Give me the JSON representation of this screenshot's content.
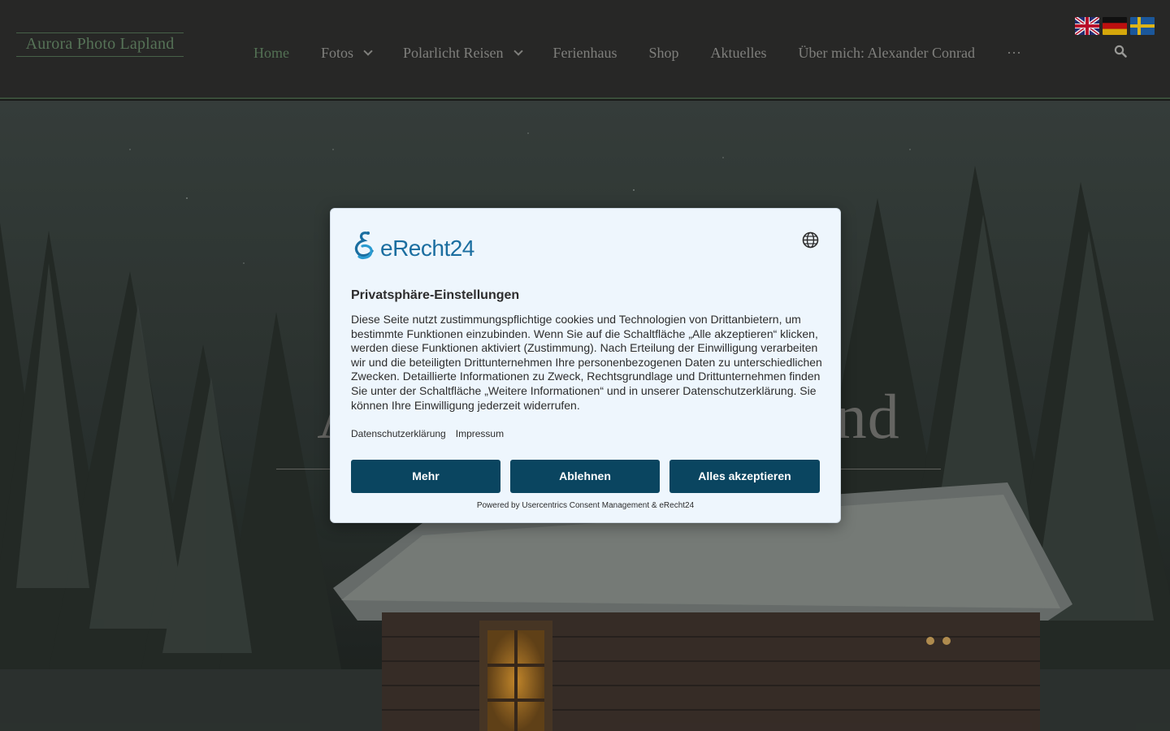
{
  "header": {
    "logo": "Aurora Photo Lapland",
    "nav": [
      {
        "label": "Home",
        "active": true,
        "dropdown": false
      },
      {
        "label": "Fotos",
        "active": false,
        "dropdown": true
      },
      {
        "label": "Polarlicht Reisen",
        "active": false,
        "dropdown": true
      },
      {
        "label": "Ferienhaus",
        "active": false,
        "dropdown": false
      },
      {
        "label": "Shop",
        "active": false,
        "dropdown": false
      },
      {
        "label": "Aktuelles",
        "active": false,
        "dropdown": false
      },
      {
        "label": "Über mich: Alexander Conrad",
        "active": false,
        "dropdown": false
      }
    ],
    "more": "···",
    "icons": {
      "search": "search-icon"
    },
    "languages": [
      "english-flag",
      "german-flag",
      "swedish-flag"
    ]
  },
  "hero": {
    "title": "Aurora Photo Lapland"
  },
  "consent": {
    "brand": "eRecht24",
    "title": "Privatsphäre-Einstellungen",
    "body": "Diese Seite nutzt zustimmungspflichtige cookies und Technologien von Drittanbietern, um bestimmte Funktionen einzubinden. Wenn Sie auf die Schaltfläche „Alle akzeptieren“ klicken, werden diese Funktionen aktiviert (Zustimmung). Nach Erteilung der Einwilligung verarbeiten wir und die beteiligten Drittunternehmen Ihre personenbezogenen Daten zu unterschiedlichen Zwecken. Detaillierte Informationen zu Zweck, Rechtsgrundlage und Drittunternehmen finden Sie unter der Schaltfläche „Weitere Informationen“ und in unserer Datenschutzerklärung. Sie können Ihre Einwilligung jederzeit widerrufen.",
    "links": {
      "privacy": "Datenschutzerklärung",
      "imprint": "Impressum"
    },
    "buttons": {
      "more": "Mehr",
      "deny": "Ablehnen",
      "accept_all": "Alles akzeptieren"
    },
    "powered_by": "Powered by Usercentrics Consent Management & eRecht24",
    "icons": {
      "language": "globe-icon",
      "logo": "erecht24-logo-icon"
    }
  },
  "colors": {
    "header_bg": "#2b2b2a",
    "accent_green": "#5b7b5c",
    "button_bg": "#0a4560",
    "dialog_bg": "#eef6fd",
    "brand_blue": "#1b6ea0"
  }
}
